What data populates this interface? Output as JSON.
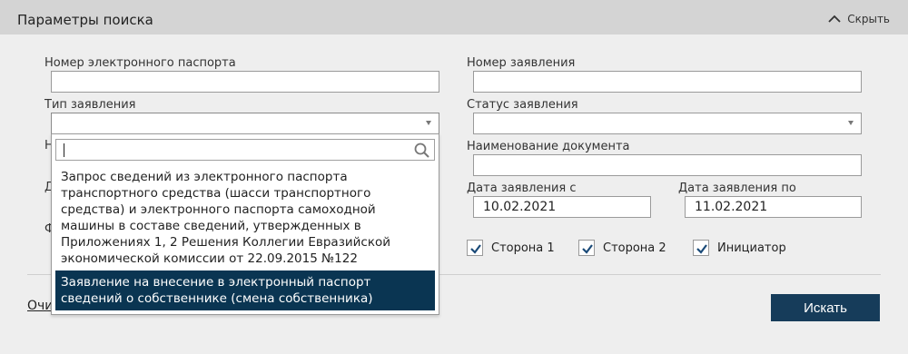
{
  "header": {
    "title": "Параметры поиска",
    "hide_label": "Скрыть"
  },
  "fields": {
    "passport_number": {
      "label": "Номер электронного паспорта",
      "value": ""
    },
    "application_number": {
      "label": "Номер заявления",
      "value": ""
    },
    "application_type": {
      "label": "Тип заявления",
      "value": ""
    },
    "application_status": {
      "label": "Статус заявления",
      "value": ""
    },
    "document_name": {
      "label": "Наименование документа",
      "value": ""
    },
    "date_from": {
      "label": "Дата заявления с",
      "value": "10.02.2021"
    },
    "date_to": {
      "label": "Дата заявления по",
      "value": "11.02.2021"
    },
    "hidden_label_1": "Н",
    "hidden_label_2": "Д",
    "hidden_label_3": "Ф"
  },
  "checkboxes": [
    {
      "label": "Сторона 1",
      "checked": true
    },
    {
      "label": "Сторона 2",
      "checked": true
    },
    {
      "label": "Инициатор",
      "checked": true
    }
  ],
  "dropdown": {
    "search_value": "",
    "options": [
      "Запрос сведений из электронного паспорта транспортного средства (шасси транспортного средства) и электронного паспорта самоходной машины в составе сведений, утвержденных в Приложениях 1, 2 Решения Коллегии Евразийской экономической комиссии от 22.09.2015 №122",
      "Заявление на внесение в электронный паспорт сведений о собственнике (смена собственника)"
    ],
    "highlighted_index": 1
  },
  "actions": {
    "clear_label": "Очистить",
    "search_label": "Искать"
  },
  "colors": {
    "header_bg": "#d4d4d4",
    "page_bg": "#eeeeee",
    "primary_button": "#163c5a",
    "highlight": "#0a3552",
    "checkbox_accent": "#1a4a78"
  },
  "icons": {
    "hide": "chevron-up-icon",
    "search": "magnifier-icon",
    "caret": "caret-down-icon",
    "check": "checkmark-icon"
  }
}
